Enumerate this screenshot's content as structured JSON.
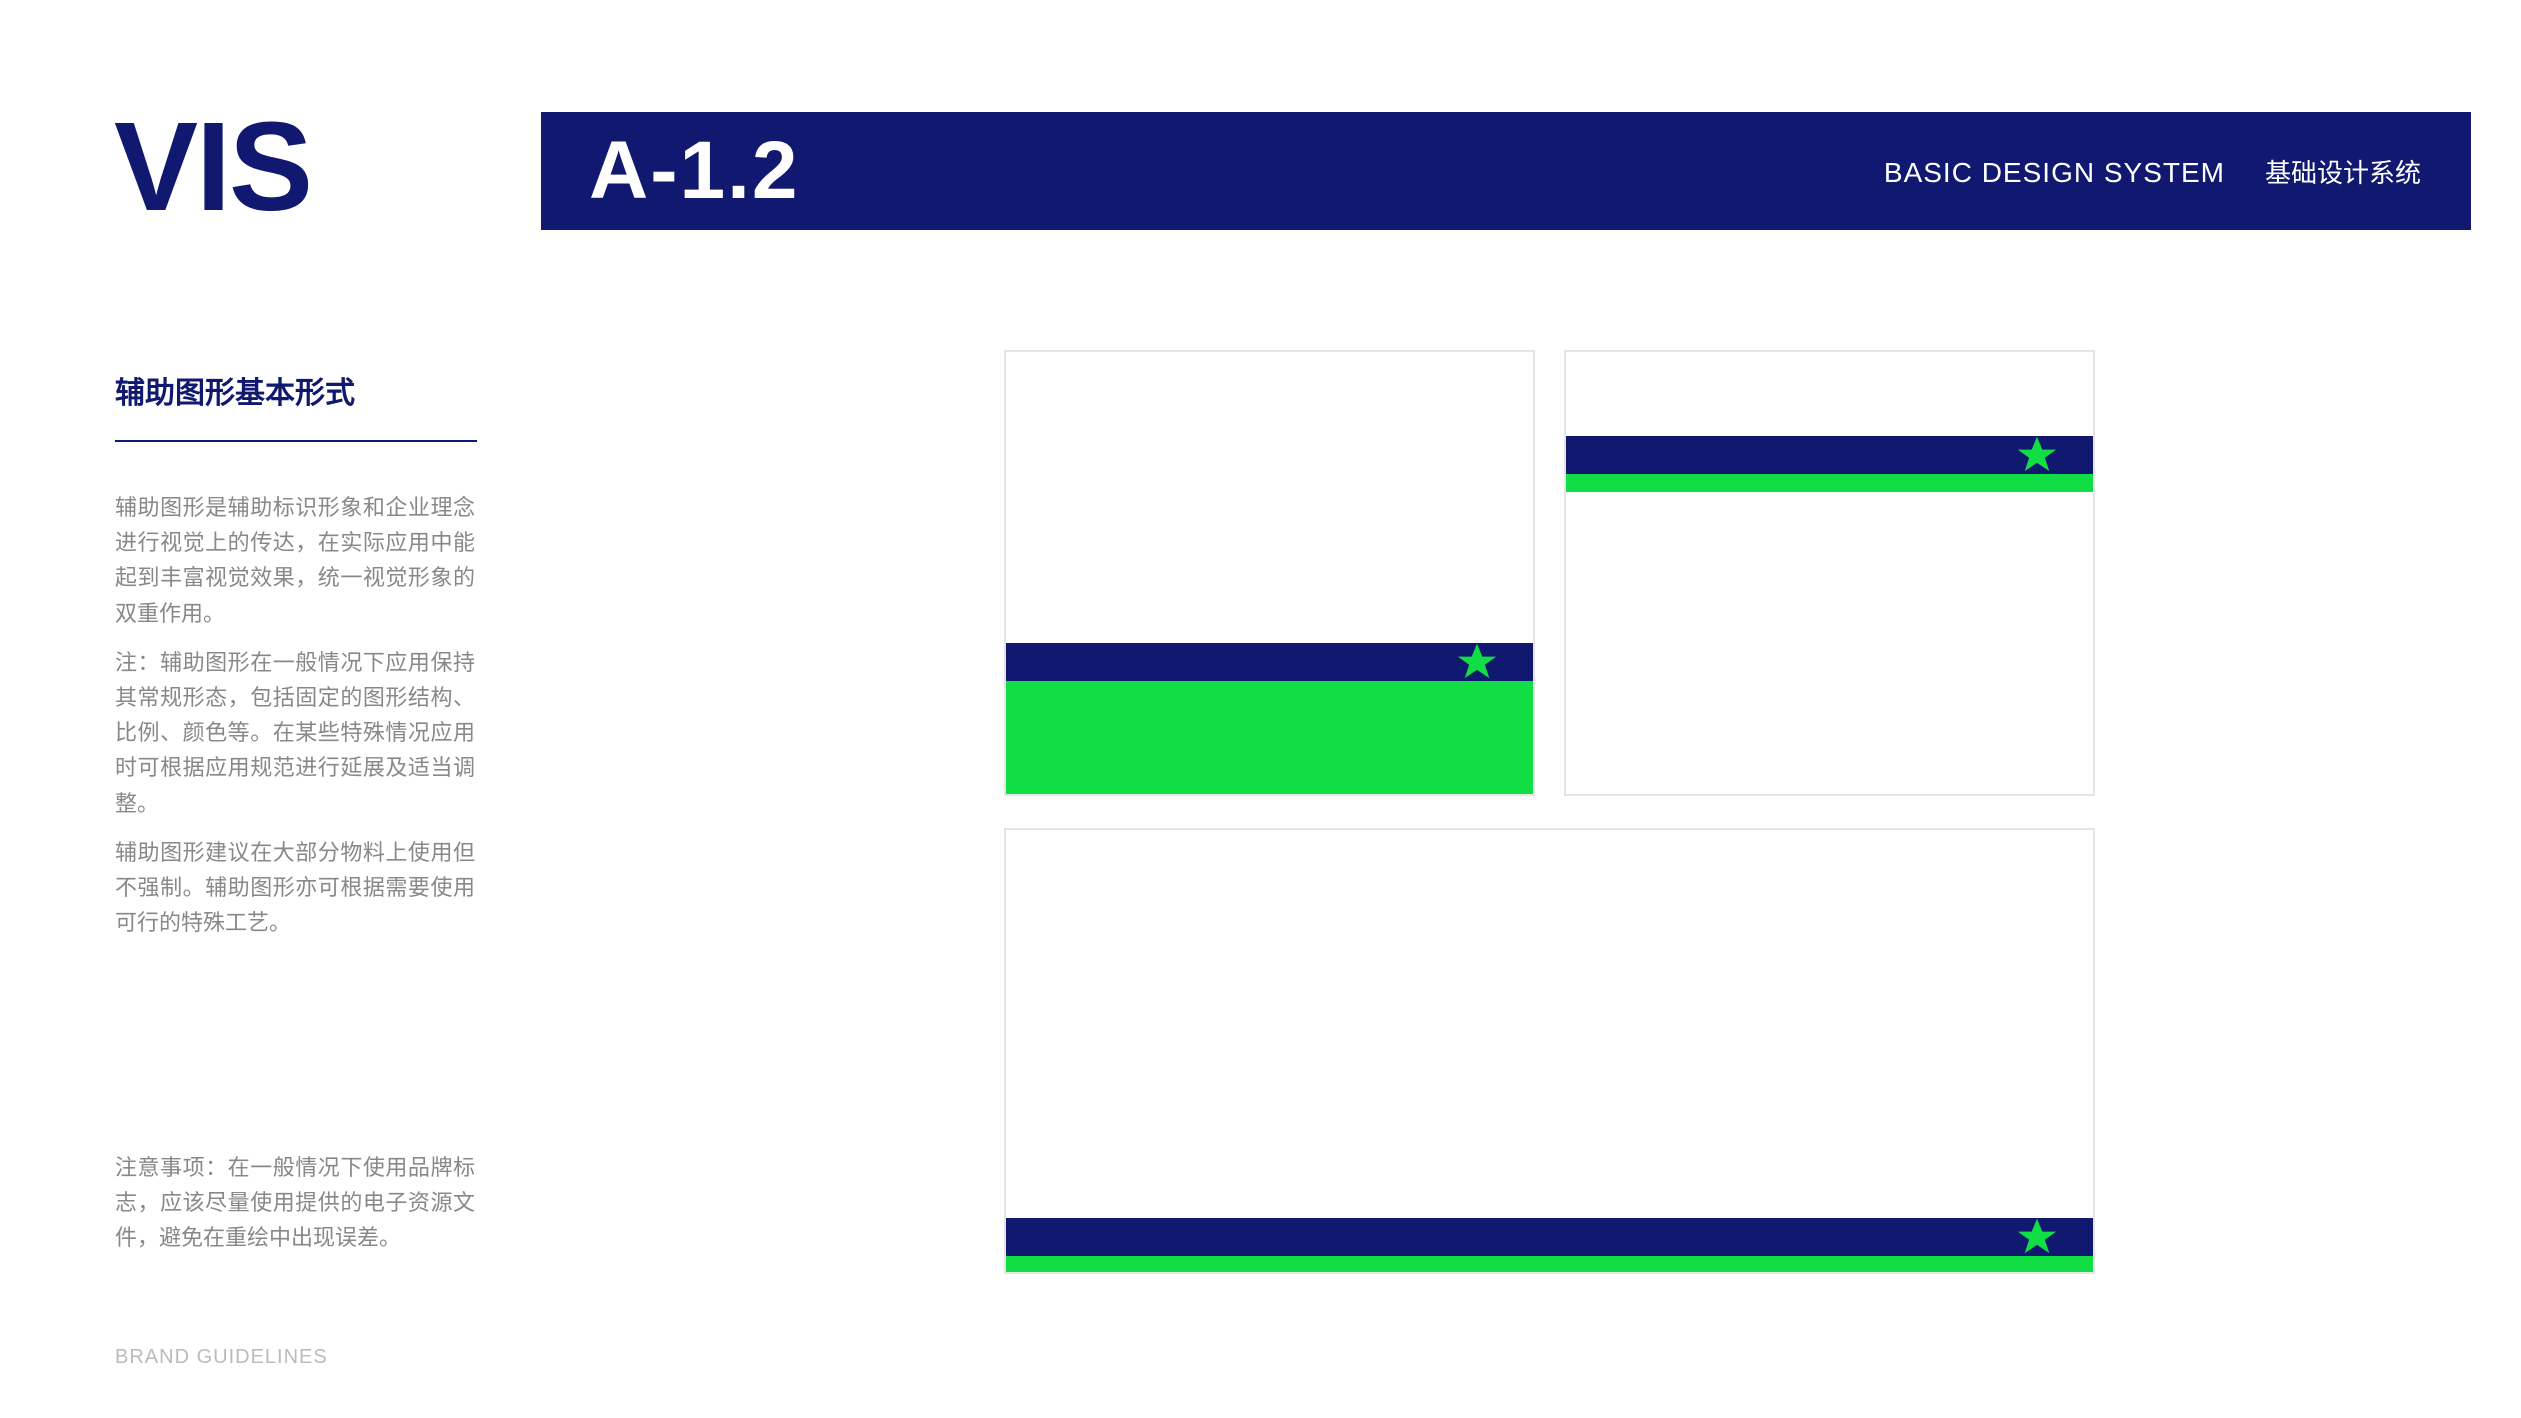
{
  "logo": "VIS",
  "header": {
    "section_code": "A-1.2",
    "label_en": "BASIC DESIGN SYSTEM",
    "label_cn": "基础设计系统"
  },
  "sidebar": {
    "title": "辅助图形基本形式",
    "para1": "辅助图形是辅助标识形象和企业理念进行视觉上的传达，在实际应用中能起到丰富视觉效果，统一视觉形象的双重作用。",
    "para2": "注：辅助图形在一般情况下应用保持其常规形态，包括固定的图形结构、比例、颜色等。在某些特殊情况应用时可根据应用规范进行延展及适当调整。",
    "para3": "辅助图形建议在大部分物料上使用但不强制。辅助图形亦可根据需要使用可行的特殊工艺。"
  },
  "notice": {
    "text": "注意事项：在一般情况下使用品牌标志，应该尽量使用提供的电子资源文件，避免在重绘中出现误差。"
  },
  "footer": "BRAND GUIDELINES",
  "colors": {
    "brand_dark": "#101870",
    "brand_green": "#11dd44"
  }
}
